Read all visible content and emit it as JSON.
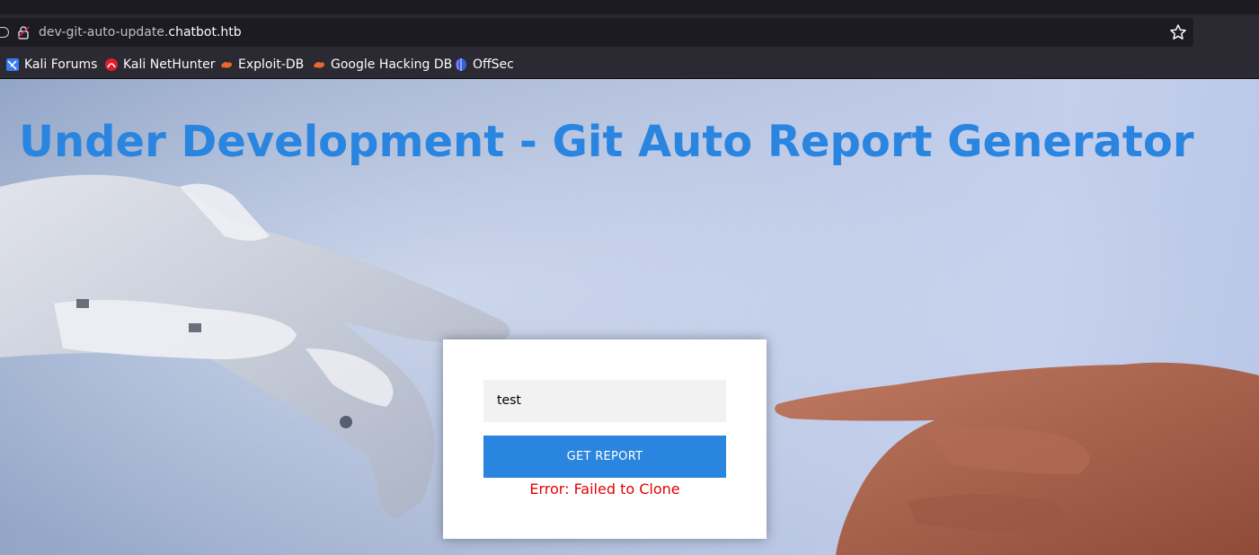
{
  "browser": {
    "url_path": "dev-git-auto-update.",
    "url_host": "chatbot.htb"
  },
  "bookmarks": [
    {
      "label": "Kali Forums",
      "icon": "kali-forums-icon"
    },
    {
      "label": "Kali NetHunter",
      "icon": "kali-nethunter-icon"
    },
    {
      "label": "Exploit-DB",
      "icon": "exploit-db-icon"
    },
    {
      "label": "Google Hacking DB",
      "icon": "google-hacking-db-icon"
    },
    {
      "label": "OffSec",
      "icon": "offsec-icon"
    }
  ],
  "page": {
    "title": "Under Development - Git Auto Report Generator",
    "input_value": "test",
    "button_label": "GET REPORT",
    "error_text": "Error: Failed to Clone"
  },
  "colors": {
    "title": "#2a85e0",
    "button": "#2985de",
    "error": "#e50000"
  }
}
